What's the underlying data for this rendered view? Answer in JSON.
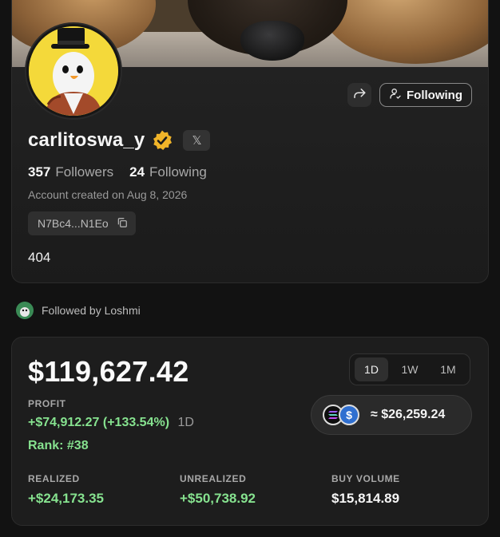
{
  "profile": {
    "username": "carlitoswa_y",
    "followers_count": "357",
    "followers_label": "Followers",
    "following_count": "24",
    "following_label": "Following",
    "created": "Account created on Aug 8, 2026",
    "address": "N7Bc4...N1Eo",
    "bio": "404",
    "follow_button_label": "Following",
    "x_label": "𝕏"
  },
  "followed_by": "Followed by Loshmi",
  "stats": {
    "balance": "$119,627.42",
    "range_tabs": [
      "1D",
      "1W",
      "1M"
    ],
    "active_range": "1D",
    "profit_label": "PROFIT",
    "profit_value": "+$74,912.27 (+133.54%)",
    "profit_period": "1D",
    "rank": "Rank: #38",
    "holdings_value": "≈ $26,259.24",
    "realized_label": "REALIZED",
    "realized_value": "+$24,173.35",
    "unrealized_label": "UNREALIZED",
    "unrealized_value": "+$50,738.92",
    "buy_volume_label": "BUY VOLUME",
    "buy_volume_value": "$15,814.89"
  },
  "icons": {
    "share": "share-icon",
    "follow": "user-check-icon",
    "verified": "verified-badge-icon",
    "copy": "copy-icon",
    "sol": "solana-icon",
    "usdc": "usdc-icon"
  },
  "colors": {
    "profit_green": "#86e28f",
    "verified_gold": "#f0b429",
    "background": "#121212"
  }
}
